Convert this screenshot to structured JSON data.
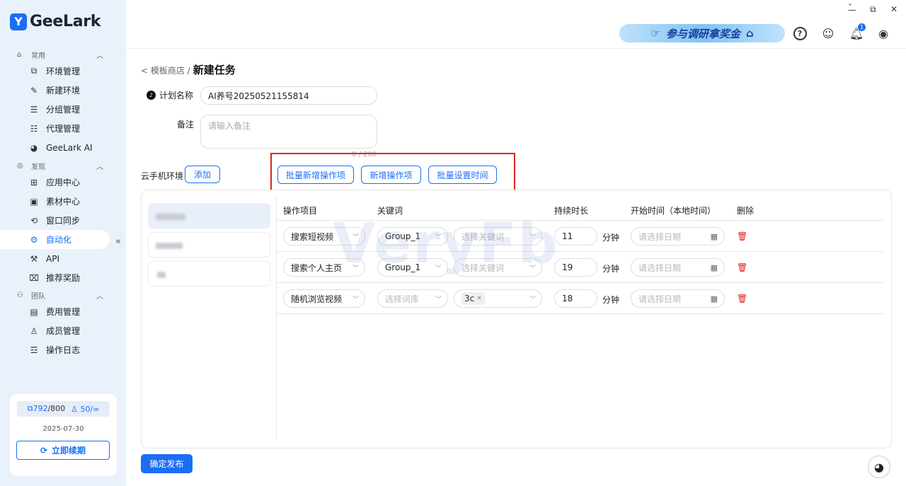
{
  "app": {
    "logo_text": "GeeLark",
    "logo_mark": "Y"
  },
  "window": {
    "pin": "ˇ",
    "minimize": "—",
    "restore": "⧉",
    "close": "✕"
  },
  "banner": {
    "text": "参与调研拿奖金"
  },
  "top_icons": {
    "notification_count": "1"
  },
  "sidebar": {
    "groups": [
      {
        "label": "常用",
        "items": [
          "环境管理",
          "新建环境",
          "分组管理",
          "代理管理",
          "GeeLark AI"
        ]
      },
      {
        "label": "发现",
        "items": [
          "应用中心",
          "素材中心",
          "窗口同步",
          "自动化",
          "API",
          "推荐奖励"
        ]
      },
      {
        "label": "团队",
        "items": [
          "费用管理",
          "成员管理",
          "操作日志"
        ]
      }
    ],
    "active_item": "自动化",
    "quota": {
      "devices_used": "792",
      "devices_total": "/800",
      "members": "50/∞",
      "date": "2025-07-30",
      "renew_label": "立即续期"
    }
  },
  "page": {
    "back_crumb": "< 模板商店 /",
    "title": "新建任务",
    "plan_name_label": "计划名称",
    "plan_name_value": "AI养号20250521155814",
    "remark_label": "备注",
    "remark_placeholder": "请输入备注",
    "remark_counter": "0 / 200",
    "cloud_env_label": "云手机环境",
    "add_button": "添加",
    "batch_add_button": "批量新增操作项",
    "add_op_button": "新增操作项",
    "batch_time_button": "批量设置时间",
    "publish_button": "确定发布",
    "watermark": "VeryFb"
  },
  "table": {
    "headers": [
      "操作项目",
      "关键词",
      "持续时长",
      "开始时间（本地时间）",
      "删除"
    ],
    "rows": [
      {
        "op": "搜索短视频",
        "keyword": "Group_1",
        "keyword_ph": false,
        "kw2": "选择关键词",
        "kw2_tag": "",
        "duration": "11",
        "unit": "分钟",
        "date_ph": "请选择日期"
      },
      {
        "op": "搜索个人主页",
        "keyword": "Group_1",
        "keyword_ph": false,
        "kw2": "选择关键词",
        "kw2_tag": "",
        "duration": "19",
        "unit": "分钟",
        "date_ph": "请选择日期"
      },
      {
        "op": "随机浏览视频",
        "keyword": "选择词库",
        "keyword_ph": true,
        "kw2": "",
        "kw2_tag": "3c",
        "duration": "18",
        "unit": "分钟",
        "date_ph": "请选择日期"
      }
    ]
  },
  "colors": {
    "accent": "#1a6ef5",
    "sidebar_bg": "#e9f1fb",
    "danger": "#e0231c"
  }
}
